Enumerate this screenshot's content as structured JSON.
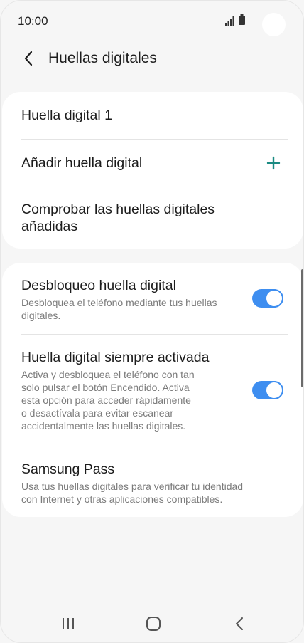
{
  "status_bar": {
    "time": "10:00"
  },
  "header": {
    "title": "Huellas digitales"
  },
  "fingerprint_card": {
    "items": [
      {
        "label": "Huella digital 1"
      },
      {
        "label": "Añadir huella digital"
      },
      {
        "label_line1": "Comprobar las huellas digitales",
        "label_line2": "añadidas"
      }
    ]
  },
  "options_card": {
    "items": [
      {
        "title": "Desbloqueo huella digital",
        "desc_line1": "Desbloquea el teléfono mediante tus huellas",
        "desc_line2": "digitales.",
        "enabled": true
      },
      {
        "title": "Huella digital siempre activada",
        "desc_line1": "Activa y desbloquea el teléfono con tan",
        "desc_line2": "solo pulsar el botón Encendido. Activa",
        "desc_line3": "esta opción para acceder rápidamente",
        "desc_line4": "o desactívala para evitar escanear",
        "desc_line5": "accidentalmente las huellas digitales.",
        "enabled": true
      },
      {
        "title": "Samsung Pass",
        "desc_line1": "Usa tus huellas digitales para verificar tu identidad",
        "desc_line2": "con Internet y otras aplicaciones compatibles."
      }
    ]
  },
  "colors": {
    "accent": "#3e8ef0",
    "plus": "#1a8a82",
    "background": "#f6f6f6",
    "card": "#ffffff"
  },
  "icons": {
    "back": "chevron-left-icon",
    "add": "plus-icon",
    "nav_recents": "recents-icon",
    "nav_home": "home-icon",
    "nav_back": "nav-back-icon",
    "signal": "signal-icon",
    "battery": "battery-icon"
  }
}
